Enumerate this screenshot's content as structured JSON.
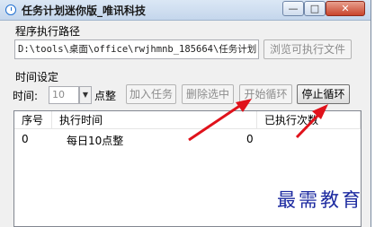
{
  "window": {
    "title": "任务计划迷你版_唯讯科技",
    "controls": {
      "minimize": "—",
      "maximize": "□",
      "close": "✕"
    }
  },
  "path_section": {
    "label": "程序执行路径",
    "value": "D:\\tools\\桌面\\office\\rwjhmnb_185664\\任务计划",
    "browse_label": "浏览可执行文件"
  },
  "time_section": {
    "label": "时间设定",
    "time_label": "时间:",
    "hour_value": "10",
    "hour_unit": "点整"
  },
  "buttons": {
    "add": "加入任务",
    "delete": "删除选中",
    "start": "开始循环",
    "stop": "停止循环"
  },
  "table": {
    "headers": [
      "序号",
      "执行时间",
      "已执行次数"
    ],
    "rows": [
      {
        "no": "0",
        "time": "每日10点整",
        "count": "0"
      }
    ]
  },
  "watermark": "最需教育",
  "colors": {
    "arrow": "#e0121b",
    "watermark": "#1c2aa0"
  }
}
